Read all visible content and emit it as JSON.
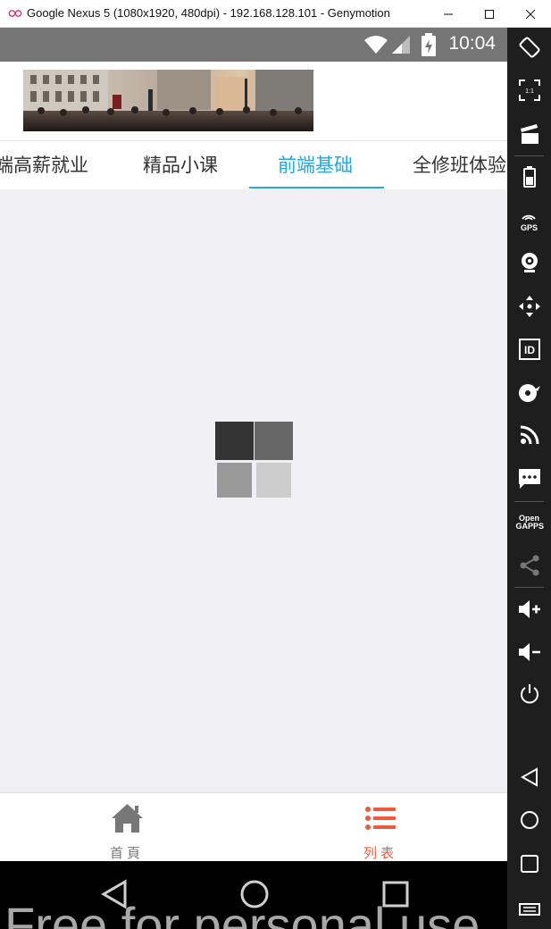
{
  "window": {
    "title": "Google Nexus 5 (1080x1920, 480dpi) - 192.168.128.101 - Genymotion",
    "controls": [
      "minimize-icon",
      "maximize-icon",
      "close-icon"
    ]
  },
  "statusbar": {
    "time": "10:04",
    "icons": [
      "wifi-icon",
      "signal-icon",
      "battery-charging-icon"
    ]
  },
  "header": {
    "banner_image": "city-street-crowd-photo"
  },
  "tabs": {
    "items": [
      {
        "label": "端高薪就业",
        "active": false
      },
      {
        "label": "精品小课",
        "active": false
      },
      {
        "label": "前端基础",
        "active": true
      },
      {
        "label": "全修班体验",
        "active": false
      }
    ],
    "active_color": "#21a8e6"
  },
  "loader": {
    "colors": [
      "#333333",
      "#666666",
      "#999999",
      "#cccccc"
    ]
  },
  "bottomnav": {
    "items": [
      {
        "label": "首頁",
        "icon": "home-icon",
        "active": false,
        "color": "#777777"
      },
      {
        "label": "列表",
        "icon": "list-icon",
        "active": true,
        "color": "#f05a3c"
      }
    ]
  },
  "system_nav": {
    "buttons": [
      "back-icon",
      "home-circle-icon",
      "recents-icon"
    ]
  },
  "watermark": "Free for personal use",
  "genymotion_toolbar": {
    "tools": [
      {
        "name": "rotate-icon"
      },
      {
        "name": "pixel-perfect-icon",
        "label": "1:1"
      },
      {
        "name": "capture-icon"
      },
      {
        "name": "battery-icon"
      },
      {
        "name": "gps-icon",
        "label": "GPS"
      },
      {
        "name": "webcam-icon"
      },
      {
        "name": "remote-control-icon"
      },
      {
        "name": "identifiers-icon",
        "label": "ID"
      },
      {
        "name": "disk-io-icon"
      },
      {
        "name": "network-icon"
      },
      {
        "name": "sms-icon"
      },
      {
        "name": "open-gapps-icon",
        "label": "Open GAPPS"
      },
      {
        "name": "share-icon"
      },
      {
        "name": "volume-up-icon"
      },
      {
        "name": "volume-down-icon"
      },
      {
        "name": "power-icon"
      },
      {
        "name": "back-nav-icon"
      },
      {
        "name": "home-nav-icon"
      },
      {
        "name": "recents-nav-icon"
      },
      {
        "name": "menu-nav-icon"
      }
    ]
  }
}
